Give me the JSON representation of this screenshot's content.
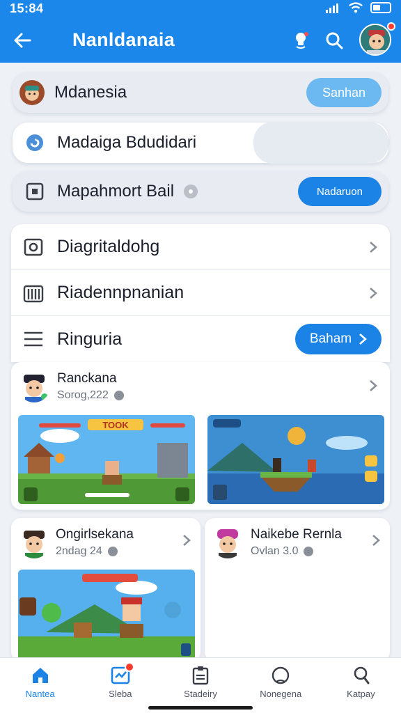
{
  "status_bar": {
    "time": "15:84"
  },
  "app_bar": {
    "title": "Nanldanaia",
    "back_icon": "arrow-left-icon",
    "actions": [
      "bulb-icon",
      "search-icon",
      "avatar"
    ]
  },
  "rows": [
    {
      "label": "Mdanesia",
      "button": "Sanhan"
    },
    {
      "label": "Madaiga Bdudidari"
    },
    {
      "label": "Mapahmort Bail",
      "button": "Nadaruon"
    }
  ],
  "menu": [
    {
      "label": "Diagritaldohg"
    },
    {
      "label": "Riadennpnanian"
    },
    {
      "label": "Ringuria",
      "button": "Baham"
    }
  ],
  "feed": [
    {
      "name": "Ranckana",
      "meta": "Sorog,222",
      "banner": "TOOK"
    },
    {
      "name": "Ongirlsekana",
      "meta": "2ndag 24"
    },
    {
      "name": "Naikebe Rernla",
      "meta": "Ovlan 3.0"
    }
  ],
  "nav": [
    {
      "label": "Nantea",
      "icon": "home-icon",
      "active": true
    },
    {
      "label": "Sleba",
      "icon": "chart-icon",
      "badge": true
    },
    {
      "label": "Stadeiry",
      "icon": "clipboard-icon"
    },
    {
      "label": "Nonegena",
      "icon": "globe-icon"
    },
    {
      "label": "Katpay",
      "icon": "profile-icon"
    }
  ],
  "colors": {
    "primary": "#1c87ea",
    "accent": "#1b83e6",
    "background": "#eef1f6",
    "badge": "#ff3b30"
  }
}
